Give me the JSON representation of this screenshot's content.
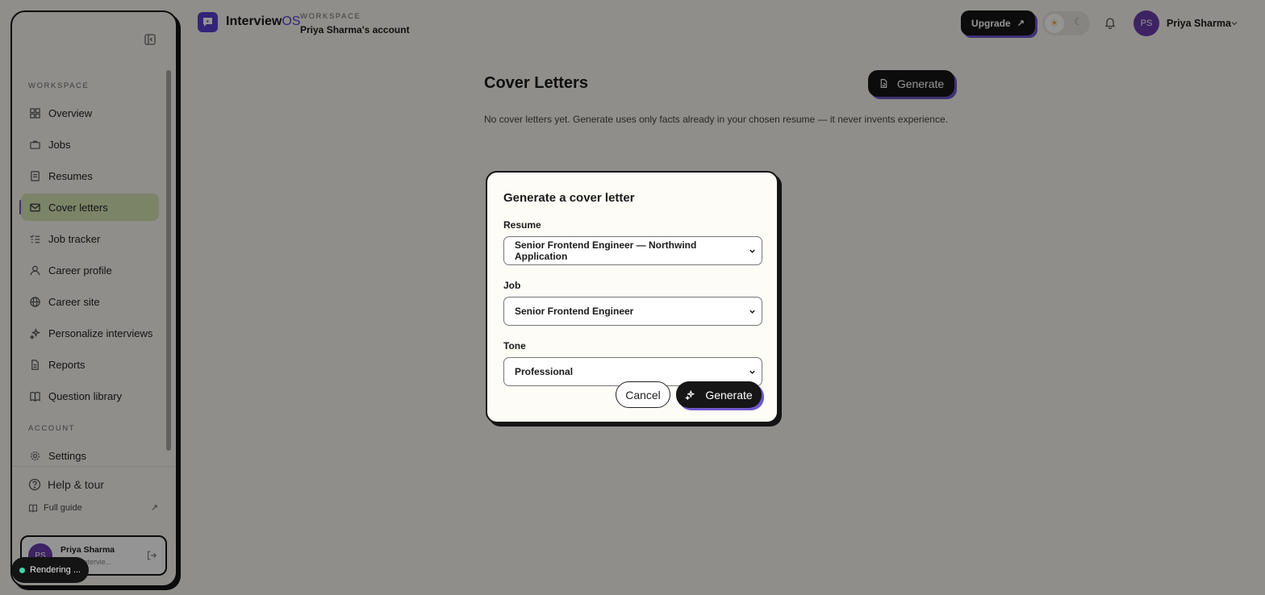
{
  "header": {
    "brand_name": "InterviewOS",
    "workspace_label": "WORKSPACE",
    "workspace_name": "Priya Sharma's account",
    "upgrade_label": "Upgrade",
    "user_initials": "PS",
    "user_name": "Priya Sharma"
  },
  "sidebar": {
    "workspace_label": "WORKSPACE",
    "items": [
      {
        "label": "Overview",
        "icon": "grid-icon"
      },
      {
        "label": "Jobs",
        "icon": "briefcase-icon"
      },
      {
        "label": "Resumes",
        "icon": "resume-icon"
      },
      {
        "label": "Cover letters",
        "icon": "mail-icon",
        "active": true
      },
      {
        "label": "Job tracker",
        "icon": "checklist-icon"
      },
      {
        "label": "Career profile",
        "icon": "person-icon"
      },
      {
        "label": "Career site",
        "icon": "globe-icon"
      },
      {
        "label": "Personalize interviews",
        "icon": "sparkle-icon"
      },
      {
        "label": "Reports",
        "icon": "document-icon"
      },
      {
        "label": "Question library",
        "icon": "book-icon"
      }
    ],
    "account_label": "ACCOUNT",
    "settings_label": "Settings",
    "help_label": "Help & tour",
    "guide_label": "Full guide",
    "user": {
      "initials": "PS",
      "name": "Priya Sharma",
      "email": "your@intervie..."
    },
    "status_toast": "Rendering ..."
  },
  "main": {
    "title": "Cover Letters",
    "generate_label": "Generate",
    "empty_text": "No cover letters yet. Generate uses only facts already in your chosen resume — it never invents experience."
  },
  "modal": {
    "title": "Generate a cover letter",
    "resume_label": "Resume",
    "resume_value": "Senior Frontend Engineer — Northwind Application",
    "job_label": "Job",
    "job_value": "Senior Frontend Engineer",
    "tone_label": "Tone",
    "tone_value": "Professional",
    "cancel_label": "Cancel",
    "generate_label": "Generate"
  },
  "colors": {
    "accent": "#5b3fcf",
    "active_nav": "#d6e3b4",
    "dark": "#161616"
  }
}
